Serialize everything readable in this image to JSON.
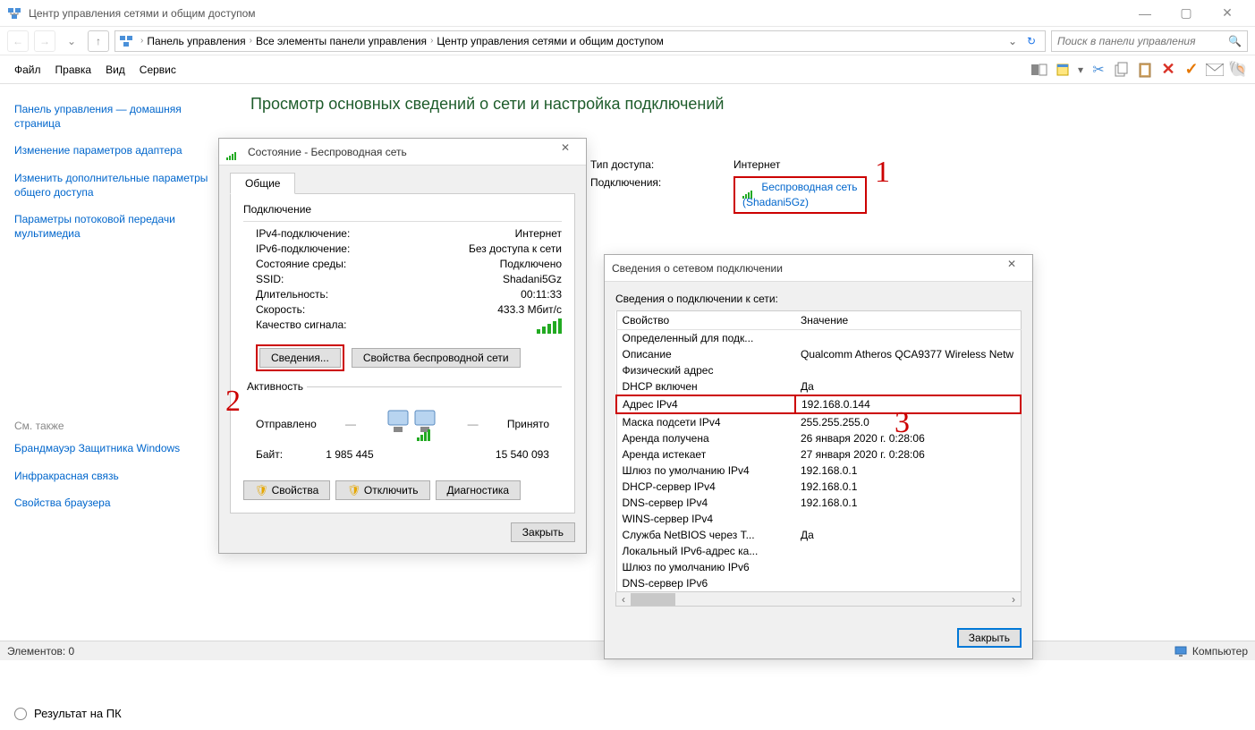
{
  "window": {
    "title": "Центр управления сетями и общим доступом"
  },
  "breadcrumb": {
    "seg1": "Панель управления",
    "seg2": "Все элементы панели управления",
    "seg3": "Центр управления сетями и общим доступом"
  },
  "search": {
    "placeholder": "Поиск в панели управления"
  },
  "menu": {
    "file": "Файл",
    "edit": "Правка",
    "view": "Вид",
    "service": "Сервис"
  },
  "sidebar": {
    "home": "Панель управления — домашняя страница",
    "link1": "Изменение параметров адаптера",
    "link2": "Изменить дополнительные параметры общего доступа",
    "link3": "Параметры потоковой передачи мультимедиа",
    "seealso": "См. также",
    "link4": "Брандмауэр Защитника Windows",
    "link5": "Инфракрасная связь",
    "link6": "Свойства браузера"
  },
  "content": {
    "heading": "Просмотр основных сведений о сети и настройка подключений",
    "access_label": "Тип доступа:",
    "access_value": "Интернет",
    "conn_label": "Подключения:",
    "conn_link_1": "Беспроводная сеть",
    "conn_link_2": "(Shadani5Gz)"
  },
  "marker1": "1",
  "marker2": "2",
  "marker3": "3",
  "statusdlg": {
    "tab": "Общие",
    "title": "Состояние - Беспроводная сеть",
    "group_conn": "Подключение",
    "ipv4_l": "IPv4-подключение:",
    "ipv4_v": "Интернет",
    "ipv6_l": "IPv6-подключение:",
    "ipv6_v": "Без доступа к сети",
    "media_l": "Состояние среды:",
    "media_v": "Подключено",
    "ssid_l": "SSID:",
    "ssid_v": "Shadani5Gz",
    "dur_l": "Длительность:",
    "dur_v": "00:11:33",
    "speed_l": "Скорость:",
    "speed_v": "433.3 Мбит/с",
    "sig_l": "Качество сигнала:",
    "det_btn": "Сведения...",
    "wprop_btn": "Свойства беспроводной сети",
    "group_act": "Активность",
    "sent": "Отправлено",
    "recv": "Принято",
    "bytes_l": "Байт:",
    "bytes_sent": "1 985 445",
    "bytes_recv": "15 540 093",
    "prop_btn": "Свойства",
    "disc_btn": "Отключить",
    "diag_btn": "Диагностика",
    "close_btn": "Закрыть"
  },
  "detdlg": {
    "title": "Сведения о сетевом подключении",
    "subtitle": "Сведения о подключении к сети:",
    "col1": "Свойство",
    "col2": "Значение",
    "rows": [
      {
        "p": "Определенный для подк...",
        "v": ""
      },
      {
        "p": "Описание",
        "v": "Qualcomm Atheros QCA9377 Wireless Netw"
      },
      {
        "p": "Физический адрес",
        "v": ""
      },
      {
        "p": "DHCP включен",
        "v": "Да"
      },
      {
        "p": "Адрес IPv4",
        "v": "192.168.0.144",
        "hl": true
      },
      {
        "p": "Маска подсети IPv4",
        "v": "255.255.255.0"
      },
      {
        "p": "Аренда получена",
        "v": "26 января 2020 г. 0:28:06"
      },
      {
        "p": "Аренда истекает",
        "v": "27 января 2020 г. 0:28:06"
      },
      {
        "p": "Шлюз по умолчанию IPv4",
        "v": "192.168.0.1"
      },
      {
        "p": "DHCP-сервер IPv4",
        "v": "192.168.0.1"
      },
      {
        "p": "DNS-сервер IPv4",
        "v": "192.168.0.1"
      },
      {
        "p": "WINS-сервер IPv4",
        "v": ""
      },
      {
        "p": "Служба NetBIOS через T...",
        "v": "Да"
      },
      {
        "p": "Локальный IPv6-адрес ка...",
        "v": ""
      },
      {
        "p": "Шлюз по умолчанию IPv6",
        "v": ""
      },
      {
        "p": "DNS-сервер IPv6",
        "v": ""
      }
    ],
    "close_btn": "Закрыть"
  },
  "statusbar": {
    "left": "Элементов: 0",
    "right": "Компьютер"
  },
  "footer": {
    "radio": "Результат на ПК"
  }
}
